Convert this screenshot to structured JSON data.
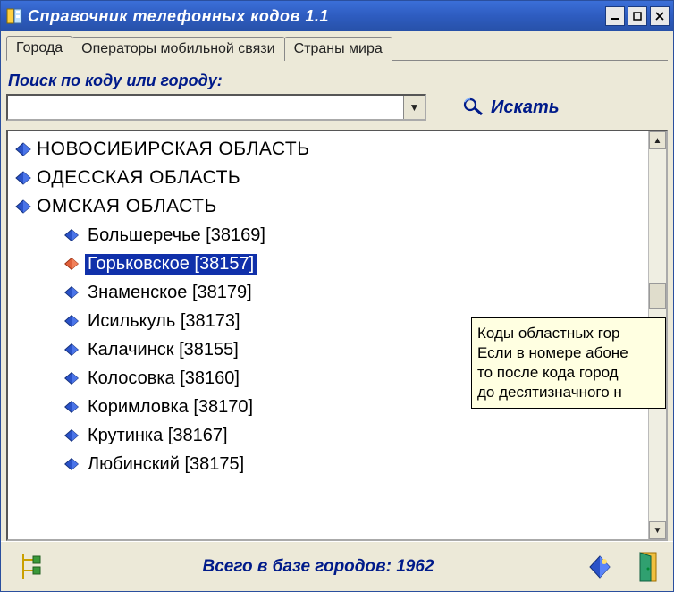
{
  "window": {
    "title": "Справочник телефонных кодов 1.1"
  },
  "tabs": [
    {
      "label": "Города",
      "active": true
    },
    {
      "label": "Операторы мобильной связи",
      "active": false
    },
    {
      "label": "Страны мира",
      "active": false
    }
  ],
  "search": {
    "label": "Поиск по коду или городу:",
    "value": "",
    "button": "Искать"
  },
  "tree": {
    "regions": [
      {
        "label": "НОВОСИБИРСКАЯ ОБЛАСТЬ"
      },
      {
        "label": "ОДЕССКАЯ ОБЛАСТЬ"
      },
      {
        "label": "ОМСКАЯ ОБЛАСТЬ"
      }
    ],
    "cities": [
      {
        "label": "Большеречье [38169]",
        "selected": false
      },
      {
        "label": "Горьковское [38157]",
        "selected": true
      },
      {
        "label": "Знаменское [38179]",
        "selected": false
      },
      {
        "label": "Исилькуль [38173]",
        "selected": false
      },
      {
        "label": "Калачинск [38155]",
        "selected": false
      },
      {
        "label": "Колосовка [38160]",
        "selected": false
      },
      {
        "label": "Коримловка [38170]",
        "selected": false
      },
      {
        "label": "Крутинка [38167]",
        "selected": false
      },
      {
        "label": "Любинский [38175]",
        "selected": false
      }
    ]
  },
  "tooltip": {
    "lines": [
      "Коды областных гор",
      "Если в номере абоне",
      "то после кода город",
      "до десятизначного н"
    ]
  },
  "status": {
    "text": "Всего в базе городов: 1962"
  }
}
